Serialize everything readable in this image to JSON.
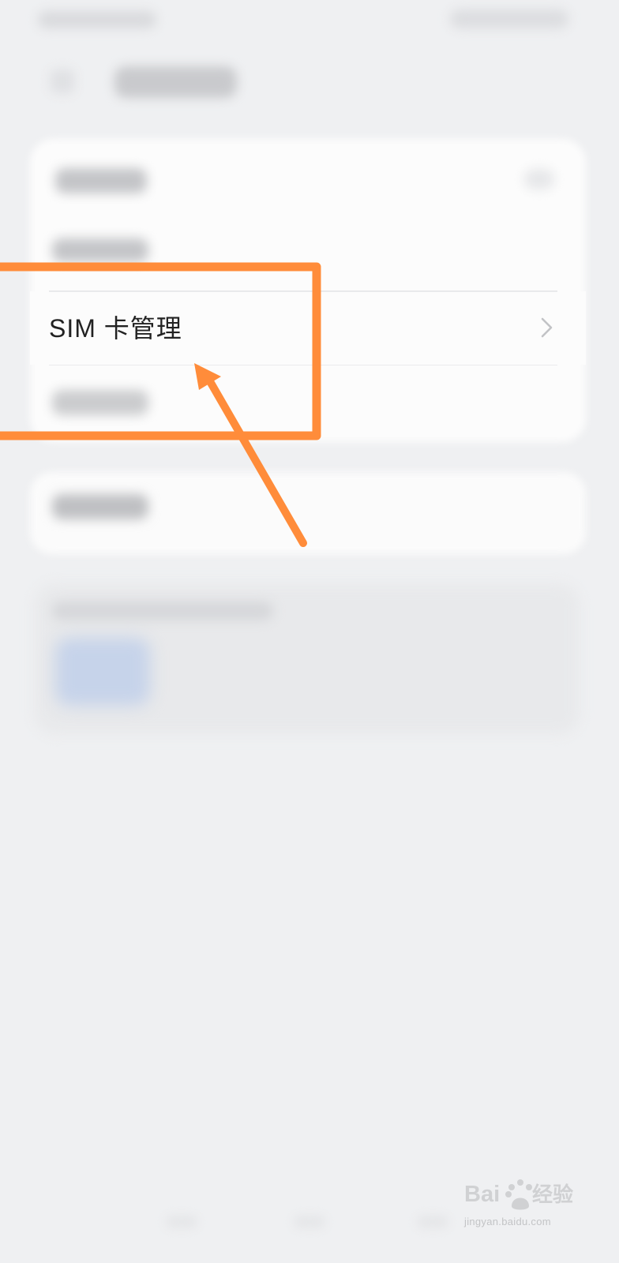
{
  "settings_list": {
    "highlighted_item": {
      "label": "SIM 卡管理",
      "icon": "chevron-right-icon"
    }
  },
  "annotation": {
    "color": "#ff8c3a",
    "shapes": [
      "highlight-box",
      "pointer-arrow"
    ]
  },
  "watermark": {
    "logo": "Baidu经验",
    "text": "jingyan.baidu.com"
  }
}
